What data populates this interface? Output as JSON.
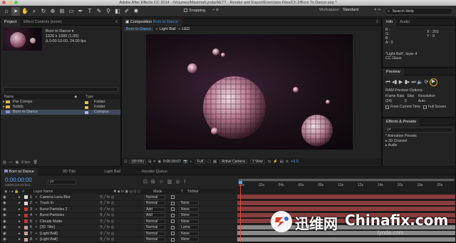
{
  "window": {
    "title": "Adobe After Effects CC 2014 - /Volumes/Maxima/Lynda/AETT - Render and Export/Exercises Files/Ch 2/Born To Dance.aep *"
  },
  "toolbar": {
    "snapping_label": "Snapping",
    "workspace_label": "Workspace:",
    "workspace_value": "Standard",
    "search_placeholder": "Search Help"
  },
  "project_panel": {
    "tabs": [
      "Project",
      "Effect Controls (none)"
    ],
    "comp_name": "Born to Dance ▾",
    "comp_info_1": "1920 x 1080 (1.00)",
    "comp_info_2": "Δ 0:00:10:00, 24.00 fps",
    "col_name": "Name",
    "col_type": "Type",
    "items": [
      {
        "name": "Pre Comps",
        "type": "Folder",
        "kind": "folder"
      },
      {
        "name": "Solids",
        "type": "Folder",
        "kind": "folder"
      },
      {
        "name": "Born to Dance",
        "type": "Compos",
        "kind": "comp"
      }
    ],
    "bpc": "8 bpc"
  },
  "composition_panel": {
    "tab_prefix": "Composition",
    "tab_name": "Born to Dance",
    "breadcrumbs": [
      "Born to Dance",
      "Light Ball",
      "LED"
    ],
    "zoom": "(30.6%)",
    "timecode": "0:00:00:07",
    "resolution": "Full",
    "camera": "Active Camera",
    "view": "1 View",
    "exposure": "+0.0"
  },
  "info_panel": {
    "tabs": [
      "Info",
      "Audio"
    ],
    "r": "R :",
    "g": "G :",
    "b": "B :",
    "a": "A : 0",
    "x": "X : 201",
    "y": "Y : 9",
    "layer_info": "\"Light Ball\", layer 4",
    "effect_info": "CC Glass"
  },
  "preview_panel": {
    "tab": "Preview",
    "ram_preview": "RAM Preview Options",
    "frame_rate_label": "Frame Rate",
    "skip_label": "Skip",
    "resolution_label": "Resolution",
    "frame_rate_value": "(24)",
    "skip_value": "0",
    "resolution_value": "Auto",
    "from_current_time": "From Current Time",
    "full_screen": "Full Screen"
  },
  "effects_panel": {
    "tab": "Effects & Presets",
    "search_placeholder": "ρ▾",
    "items": [
      "* Animation Presets",
      "▸ 3D Channel",
      "▸ Audio"
    ]
  },
  "timeline": {
    "tabs": [
      "Born to Dance",
      "3D Title",
      "Light Ball",
      "Render Queue"
    ],
    "timecode": "0:00:00:00",
    "fps": "00000 (24.00 fps)",
    "search_placeholder": "ρ▾",
    "col_hash": "#",
    "col_layer": "Layer Name",
    "col_mode": "Mode",
    "col_t": "T",
    "col_trkmat": "TrkMat",
    "ruler": [
      "00s",
      "02s",
      "04s",
      "06s",
      "08s",
      "10s",
      "12s",
      "14s",
      "16s",
      "18s",
      "20s"
    ],
    "layers": [
      {
        "num": "1",
        "name": "Camera Lens Blur",
        "color": "#d9d9d9",
        "mode": "Normal",
        "trkmat": "",
        "bar": "#8a3d3d"
      },
      {
        "num": "2",
        "name": "Track In",
        "color": "#d9d9d9",
        "mode": "Normal",
        "trkmat": "None",
        "bar": "#8a3d3d"
      },
      {
        "num": "3",
        "name": "Burst Particles 2",
        "color": "#c4362f",
        "mode": "Add",
        "trkmat": "None",
        "bar": "#8a3d3d"
      },
      {
        "num": "4",
        "name": "Burst Particles",
        "color": "#c4362f",
        "mode": "Add",
        "trkmat": "None",
        "bar": "#8a3d3d"
      },
      {
        "num": "5",
        "name": "Clouds Matte",
        "color": "#c4362f",
        "mode": "Normal",
        "trkmat": "None",
        "bar": "#8a3d3d"
      },
      {
        "num": "6",
        "name": "[3D Title]",
        "color": "#c9a0a0",
        "mode": "Normal",
        "trkmat": "Luma",
        "bar": "#8a8a8a"
      },
      {
        "num": "7",
        "name": "[Light Ball]",
        "color": "#c9a0a0",
        "mode": "Normal",
        "trkmat": "None",
        "bar": "#8a8a8a"
      },
      {
        "num": "8",
        "name": "[Light Ball]",
        "color": "#c9a0a0",
        "mode": "Normal",
        "trkmat": "None",
        "bar": "#8a8a8a"
      }
    ]
  },
  "watermark": {
    "brand_cn": "迅维网",
    "brand_en": "Chinafix.com",
    "sub": "lynda.com"
  },
  "colors": {
    "accent": "#3a8ee6",
    "highlight_ring": "#f0a020",
    "panel_bg": "#232323",
    "timeline_bar": "#8a3d3d"
  }
}
